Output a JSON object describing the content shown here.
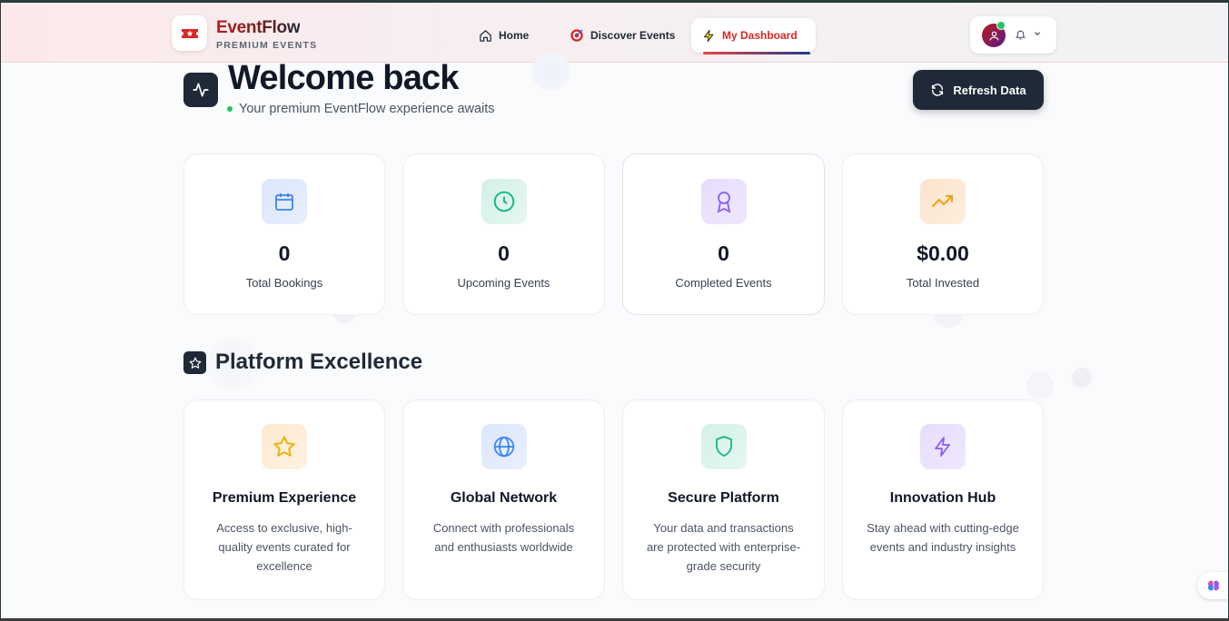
{
  "brand": {
    "name": "EventFlow",
    "tagline": "PREMIUM EVENTS",
    "logo_icon": "ticket-icon",
    "accent_color": "#dc2626"
  },
  "nav": {
    "items": [
      {
        "label": "Home",
        "icon": "home-icon"
      },
      {
        "label": "Discover Events",
        "icon": "target-icon"
      },
      {
        "label": "My Dashboard",
        "icon": "lightning-icon",
        "active": true
      }
    ]
  },
  "user": {
    "avatar_icon": "user-icon",
    "status": "online",
    "notification_icon": "bell-icon",
    "menu_icon": "chevron-down-icon"
  },
  "welcome": {
    "title": "Welcome back",
    "subtitle": "Your premium EventFlow experience awaits",
    "refresh_label": "Refresh Data"
  },
  "stats": [
    {
      "value": "0",
      "label": "Total Bookings",
      "icon": "calendar-icon",
      "color": "#3b82f6"
    },
    {
      "value": "0",
      "label": "Upcoming Events",
      "icon": "clock-icon",
      "color": "#10b981"
    },
    {
      "value": "0",
      "label": "Completed Events",
      "icon": "award-icon",
      "color": "#8b5cf6"
    },
    {
      "value": "$0.00",
      "label": "Total Invested",
      "icon": "trending-up-icon",
      "color": "#f59e0b"
    }
  ],
  "platform": {
    "title": "Platform Excellence",
    "features": [
      {
        "title": "Premium Experience",
        "description": "Access to exclusive, high-quality events curated for excellence",
        "icon": "star-icon",
        "color": "#eab308"
      },
      {
        "title": "Global Network",
        "description": "Connect with professionals and enthusiasts worldwide",
        "icon": "globe-icon",
        "color": "#3b82f6"
      },
      {
        "title": "Secure Platform",
        "description": "Your data and transactions are protected with enterprise-grade security",
        "icon": "shield-icon",
        "color": "#10b981"
      },
      {
        "title": "Innovation Hub",
        "description": "Stay ahead with cutting-edge events and industry insights",
        "icon": "lightning-icon",
        "color": "#8b5cf6"
      }
    ]
  }
}
